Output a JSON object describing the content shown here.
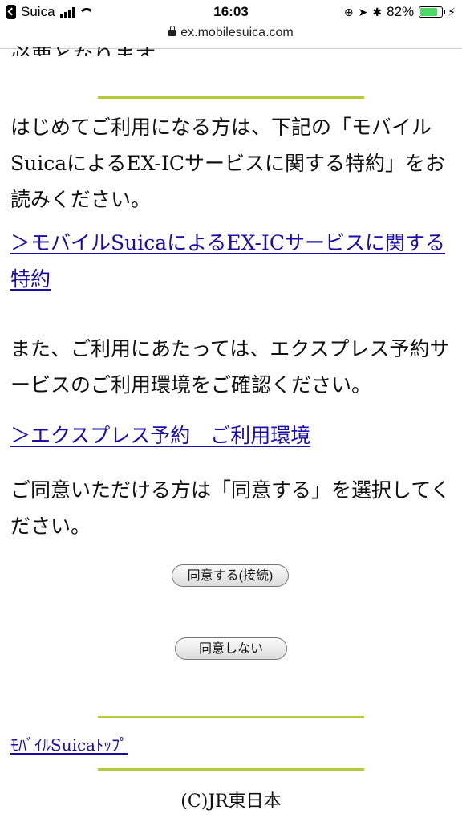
{
  "status_bar": {
    "carrier": "Suica",
    "time": "16:03",
    "battery_percent": "82%",
    "battery_level": 0.82,
    "battery_color": "#4cd964"
  },
  "url_bar": {
    "url": "ex.mobilesuica.com"
  },
  "page": {
    "cut_text": "必要となります。",
    "para1": "はじめてご利用になる方は、下記の「モバイルSuicaによるEX-ICサービスに関する特約」をお読みください。",
    "link1": "＞モバイルSuicaによるEX-ICサービスに関する特約",
    "para2": "また、ご利用にあたっては、エクスプレス予約サービスのご利用環境をご確認ください。",
    "link2": "＞エクスプレス予約　ご利用環境",
    "para3": "ご同意いただける方は「同意する」を選択してください。",
    "agree_button": "同意する(接続)",
    "disagree_button": "同意しない",
    "top_link": "ﾓﾊﾞｲﾙSuicaﾄｯﾌﾟ",
    "copyright": "(C)JR東日本"
  },
  "colors": {
    "rule": "#b4cc3c",
    "link": "#1a0dab"
  }
}
